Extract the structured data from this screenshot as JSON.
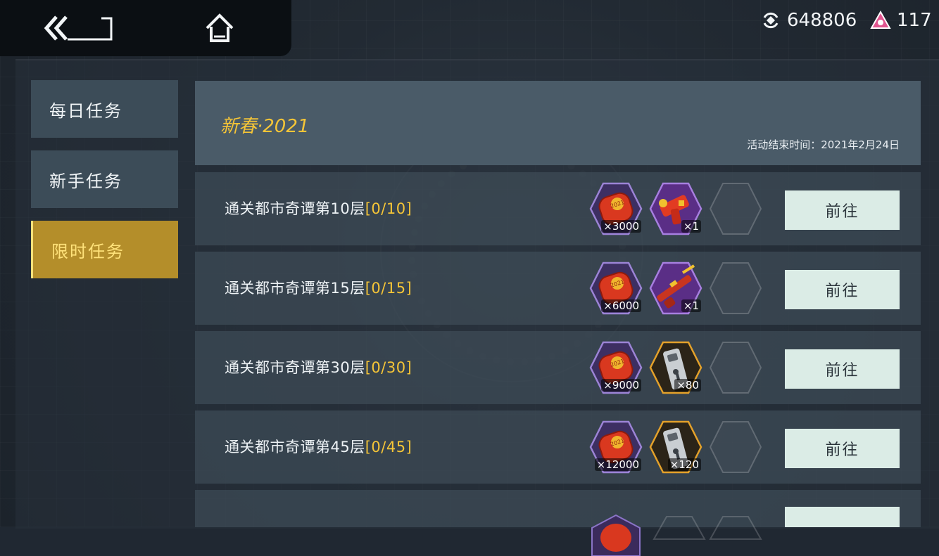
{
  "currency": {
    "coins": "648806",
    "gems": "117"
  },
  "sidebar": {
    "items": [
      {
        "label": "每日任务"
      },
      {
        "label": "新手任务"
      },
      {
        "label": "限时任务"
      }
    ],
    "active_index": 2
  },
  "event": {
    "title": "新春·2021",
    "end_time": "活动结束时间：2021年2月24日"
  },
  "tasks": [
    {
      "label": "通关都市奇谭第10层",
      "progress": "[0/10]",
      "reward1_qty": "×3000",
      "reward2_qty": "×1",
      "reward2_icon": "pistol-icon",
      "button": "前往"
    },
    {
      "label": "通关都市奇谭第15层",
      "progress": "[0/15]",
      "reward1_qty": "×6000",
      "reward2_qty": "×1",
      "reward2_icon": "rifle-icon",
      "button": "前往"
    },
    {
      "label": "通关都市奇谭第30层",
      "progress": "[0/30]",
      "reward1_qty": "×9000",
      "reward2_qty": "×80",
      "reward2_icon": "cartridge-icon",
      "button": "前往"
    },
    {
      "label": "通关都市奇谭第45层",
      "progress": "[0/45]",
      "reward1_qty": "×12000",
      "reward2_qty": "×120",
      "reward2_icon": "cartridge-icon",
      "button": "前往"
    }
  ],
  "colors": {
    "accent": "#f5c537",
    "active_tab": "#b48e2a",
    "button_bg": "#dbece6",
    "red_packet": "#d9381f"
  }
}
